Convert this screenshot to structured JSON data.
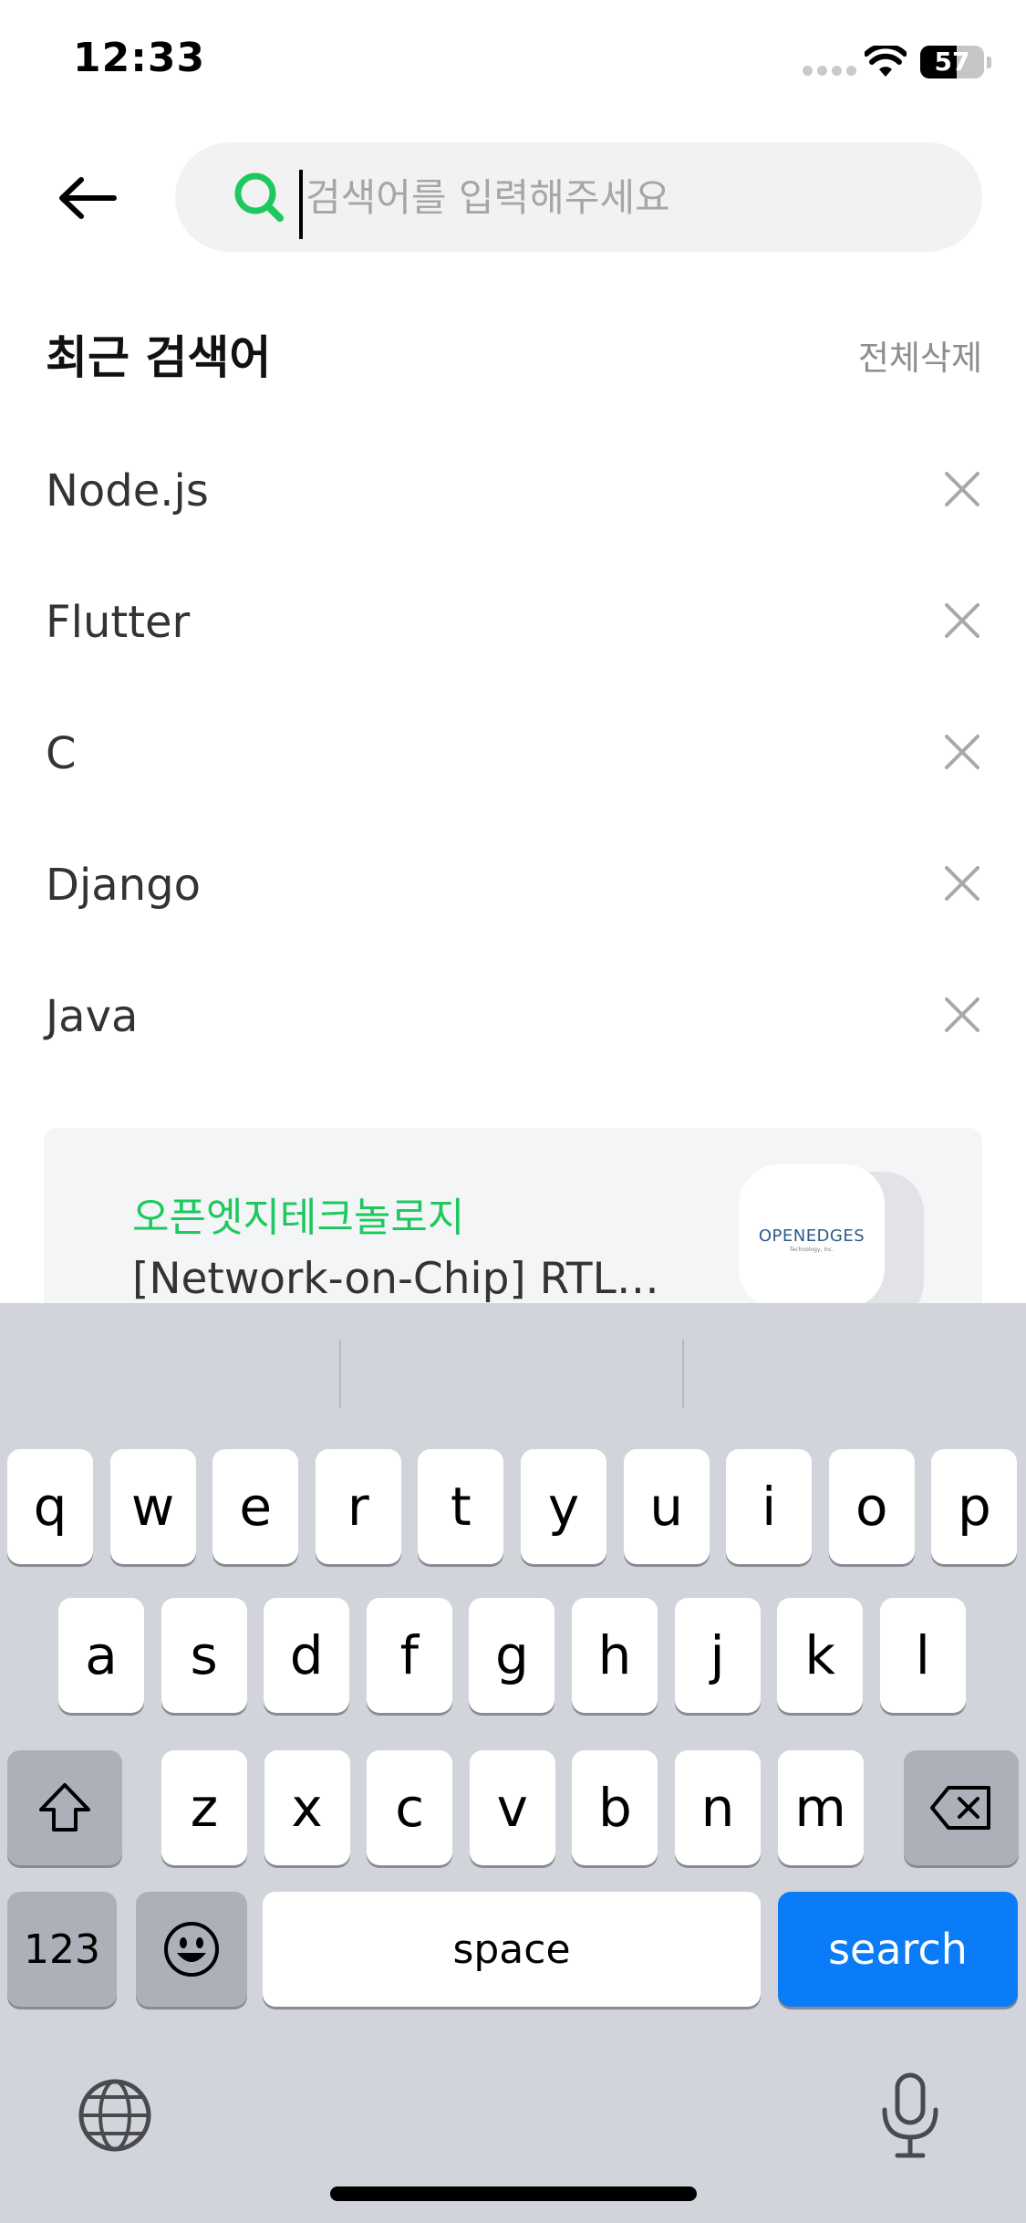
{
  "status_bar": {
    "time": "12:33",
    "battery": "57",
    "battery_level": 0.57
  },
  "search": {
    "placeholder": "검색어를 입력해주세요",
    "value": ""
  },
  "recent": {
    "title": "최근 검색어",
    "delete_all": "전체삭제",
    "items": [
      {
        "label": "Node.js"
      },
      {
        "label": "Flutter"
      },
      {
        "label": "C"
      },
      {
        "label": "Django"
      },
      {
        "label": "Java"
      }
    ]
  },
  "promo": {
    "company": "오픈엣지테크놀로지",
    "title": "[Network-on-Chip] RTL…",
    "logo_text": "OPENEDGES",
    "logo_subtext": "Technology, Inc."
  },
  "keyboard": {
    "row1": [
      "q",
      "w",
      "e",
      "r",
      "t",
      "y",
      "u",
      "i",
      "o",
      "p"
    ],
    "row2": [
      "a",
      "s",
      "d",
      "f",
      "g",
      "h",
      "j",
      "k",
      "l"
    ],
    "row3": [
      "z",
      "x",
      "c",
      "v",
      "b",
      "n",
      "m"
    ],
    "numbers_key": "123",
    "space_key": "space",
    "search_key": "search"
  },
  "colors": {
    "accent_green": "#1ec85f",
    "search_blue": "#0b7cf7"
  }
}
